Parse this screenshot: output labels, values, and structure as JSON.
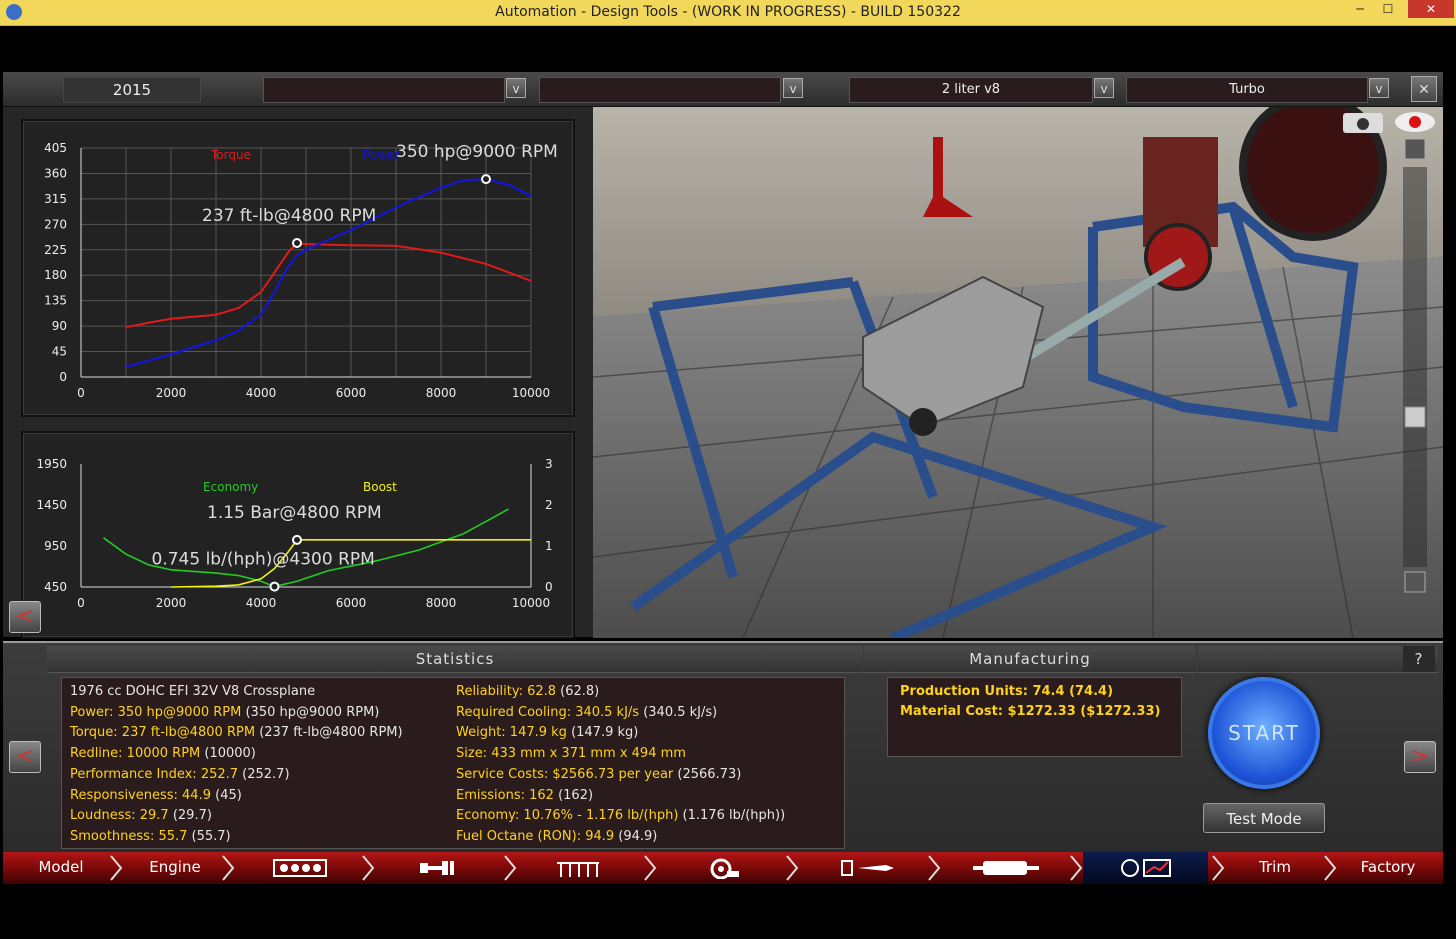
{
  "window": {
    "title": "Automation - Design Tools - (WORK IN PROGRESS) - BUILD 150322",
    "min": "─",
    "max": "☐",
    "close": "✕"
  },
  "topbar": {
    "year": "2015",
    "field2": "",
    "field3": "",
    "engine_family": "2 liter v8",
    "aspiration": "Turbo",
    "dropdown_glyph": "v",
    "close_glyph": "✕"
  },
  "chart_data": [
    {
      "type": "line",
      "title": "",
      "legend": [
        "Torque",
        "Power"
      ],
      "x_ticks": [
        0,
        2000,
        4000,
        6000,
        8000,
        10000
      ],
      "y_ticks": [
        0,
        45,
        90,
        135,
        180,
        225,
        270,
        315,
        360,
        405
      ],
      "xlim": [
        0,
        10000
      ],
      "ylim": [
        0,
        405
      ],
      "grid": true,
      "series": [
        {
          "name": "Torque",
          "color": "#e01a1a",
          "x": [
            1000,
            1500,
            2000,
            3000,
            3500,
            4000,
            4300,
            4600,
            4800,
            5000,
            6000,
            7000,
            8000,
            9000,
            10000
          ],
          "y": [
            88,
            96,
            103,
            110,
            122,
            150,
            185,
            220,
            237,
            235,
            233,
            232,
            220,
            200,
            170
          ]
        },
        {
          "name": "Power",
          "color": "#1414e6",
          "x": [
            1000,
            2000,
            3000,
            3500,
            4000,
            4300,
            4600,
            4800,
            5000,
            6000,
            7000,
            8000,
            8500,
            9000,
            9500,
            10000
          ],
          "y": [
            18,
            40,
            65,
            82,
            110,
            150,
            195,
            215,
            225,
            260,
            300,
            335,
            348,
            350,
            340,
            320
          ]
        }
      ],
      "annotations": [
        {
          "text": "350 hp@9000 RPM",
          "x": 9000,
          "y": 350
        },
        {
          "text": "237 ft-lb@4800 RPM",
          "x": 4800,
          "y": 237
        }
      ]
    },
    {
      "type": "line",
      "title": "",
      "legend": [
        "Economy",
        "Boost"
      ],
      "x_ticks": [
        0,
        2000,
        4000,
        6000,
        8000,
        10000
      ],
      "y_left_ticks": [
        450,
        950,
        1450,
        1950
      ],
      "y_right_ticks": [
        0,
        1,
        2,
        3
      ],
      "xlim": [
        0,
        10000
      ],
      "ylim_left": [
        450,
        1950
      ],
      "ylim_right": [
        0,
        3
      ],
      "grid": false,
      "series": [
        {
          "name": "Economy",
          "color": "#22cc22",
          "x": [
            500,
            1000,
            1500,
            2000,
            3000,
            3500,
            4000,
            4300,
            4800,
            5500,
            6500,
            7500,
            8500,
            9000,
            9500
          ],
          "y": [
            1050,
            850,
            720,
            660,
            620,
            590,
            520,
            455,
            520,
            650,
            760,
            900,
            1100,
            1250,
            1400
          ]
        },
        {
          "name": "Boost",
          "color": "#f2f20e",
          "x": [
            2000,
            3000,
            3500,
            4000,
            4300,
            4600,
            4800,
            6000,
            8000,
            10000
          ],
          "y": [
            0.0,
            0.02,
            0.05,
            0.2,
            0.45,
            0.85,
            1.15,
            1.15,
            1.15,
            1.15
          ]
        }
      ],
      "annotations": [
        {
          "text": "1.15 Bar@4800 RPM",
          "x": 4800,
          "y_right": 1.15
        },
        {
          "text": "0.745 lb/(hph)@4300 RPM",
          "x": 4300,
          "y": 455
        }
      ]
    }
  ],
  "statistics": {
    "header": "Statistics",
    "col1": [
      {
        "label": "1976 cc DOHC EFI 32V V8 Crossplane",
        "paren": ""
      },
      {
        "label": "Power: 350 hp@9000 RPM",
        "paren": "(350 hp@9000 RPM)"
      },
      {
        "label": "Torque: 237 ft-lb@4800 RPM",
        "paren": "(237 ft-lb@4800 RPM)"
      },
      {
        "label": "Redline: 10000 RPM",
        "paren": "(10000)"
      },
      {
        "label": "Performance Index: 252.7",
        "paren": "(252.7)"
      },
      {
        "label": "Responsiveness: 44.9",
        "paren": "(45)"
      },
      {
        "label": "Loudness: 29.7",
        "paren": "(29.7)"
      },
      {
        "label": "Smoothness: 55.7",
        "paren": "(55.7)"
      }
    ],
    "col2": [
      {
        "label": "Reliability: 62.8",
        "paren": "(62.8)"
      },
      {
        "label": "Required Cooling: 340.5 kJ/s",
        "paren": "(340.5 kJ/s)"
      },
      {
        "label": "Weight: 147.9 kg",
        "paren": "(147.9 kg)"
      },
      {
        "label": "Size: 433 mm x 371 mm x 494 mm",
        "paren": ""
      },
      {
        "label": "Service Costs: $2566.73 per year",
        "paren": "(2566.73)"
      },
      {
        "label": "Emissions: 162",
        "paren": "(162)"
      },
      {
        "label": "Economy: 10.76% - 1.176 lb/(hph)",
        "paren": "(1.176 lb/(hph))"
      },
      {
        "label": "Fuel Octane (RON): 94.9",
        "paren": "(94.9)"
      }
    ]
  },
  "manufacturing": {
    "header": "Manufacturing",
    "lines": [
      "Production Units: 74.4 (74.4)",
      "Material Cost: $1272.33 ($1272.33)"
    ]
  },
  "actions": {
    "help": "?",
    "start": "START",
    "test_mode": "Test Mode",
    "prev": "<",
    "next": ">"
  },
  "nav": {
    "model": "Model",
    "engine": "Engine",
    "trim": "Trim",
    "factory": "Factory"
  },
  "colors": {
    "accent_red": "#b31515",
    "stat_yellow": "#ffd21a",
    "start_blue": "#2a6cf0"
  }
}
